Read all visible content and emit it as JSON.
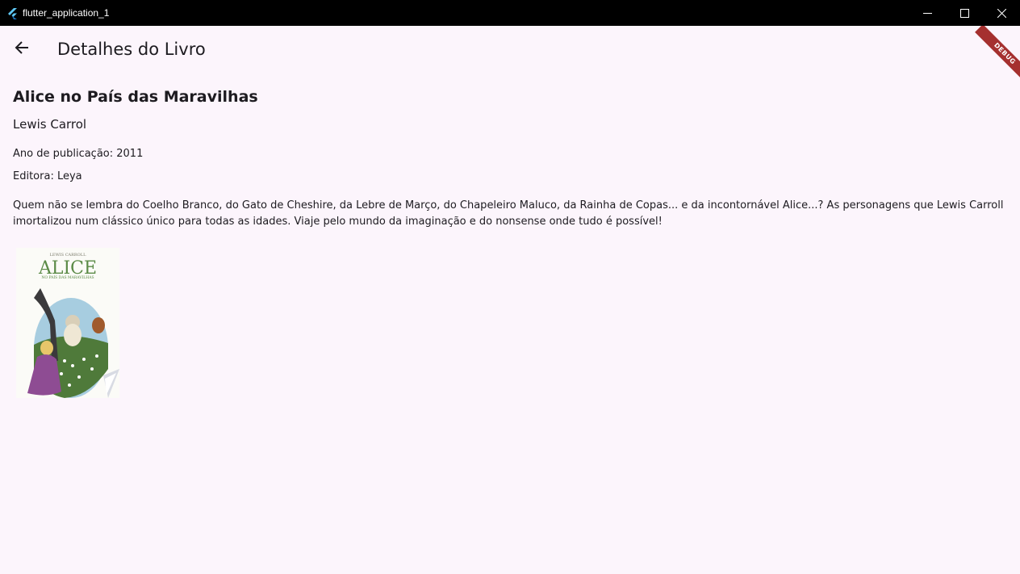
{
  "window": {
    "title": "flutter_application_1",
    "icon": "flutter-logo-icon",
    "controls": [
      "minimize-icon",
      "maximize-icon",
      "close-icon"
    ]
  },
  "appbar": {
    "back_icon": "arrow-back-icon",
    "title": "Detalhes do Livro"
  },
  "debug_banner": "DEBUG",
  "book": {
    "title": "Alice no País das Maravilhas",
    "author": "Lewis Carrol",
    "year_text": "Ano de publicação: 2011",
    "publisher_text": "Editora: Leya",
    "description": "Quem não se lembra do Coelho Branco, do Gato de Cheshire, da Lebre de Março, do Chapeleiro Maluco, da Rainha de Copas... e da incontornável Alice...? As personagens que Lewis Carroll imortalizou num clássico único para todas as idades. Viaje pelo mundo da imaginação e do nonsense onde tudo é possível!",
    "cover": {
      "author_line": "LEWIS CARROLL",
      "title_line": "ALICE",
      "subtitle_line": "NO PAÍS DAS MARAVILHAS"
    }
  },
  "colors": {
    "background": "#fcf5fc",
    "titlebar": "#000000",
    "text": "#1d1b20",
    "debug_banner": "#a5302f"
  }
}
